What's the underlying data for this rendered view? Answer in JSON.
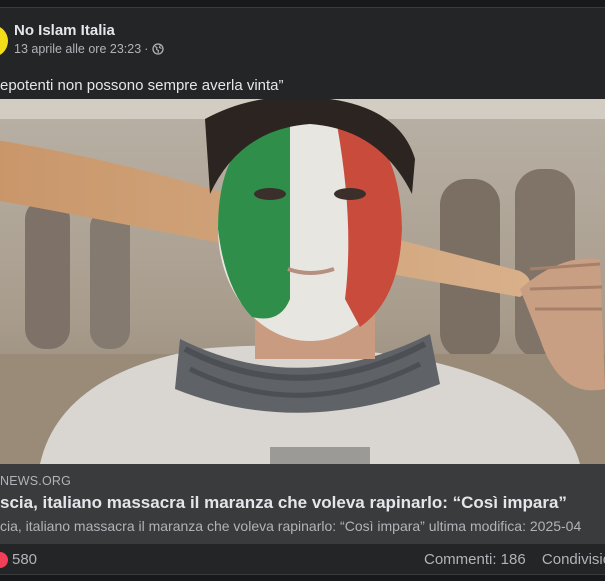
{
  "post": {
    "page_name": "No Islam Italia",
    "timestamp": "13 aprile alle ore 23:23",
    "separator": "·",
    "privacy_icon": "globe-icon",
    "text": "epotenti non possono sempre averla vinta”"
  },
  "link": {
    "domain": "NEWS.ORG",
    "headline": "scia, italiano massacra il maranza che voleva rapinarlo: “Così impara”",
    "description": "cia, italiano massacra il maranza che voleva rapinarlo: “Così impara” ultima modifica: 2025-04"
  },
  "footer": {
    "reaction_icon": "heart-reaction-icon",
    "reaction_count": "580",
    "comments": "Commenti: 186",
    "shares": "Condivisio"
  },
  "colors": {
    "background": "#18191a",
    "card": "#242526",
    "link_box": "#3a3b3c",
    "text_primary": "#e4e6eb",
    "text_secondary": "#b0b3b8",
    "avatar": "#f3dd1b",
    "reaction": "#f33e58"
  }
}
